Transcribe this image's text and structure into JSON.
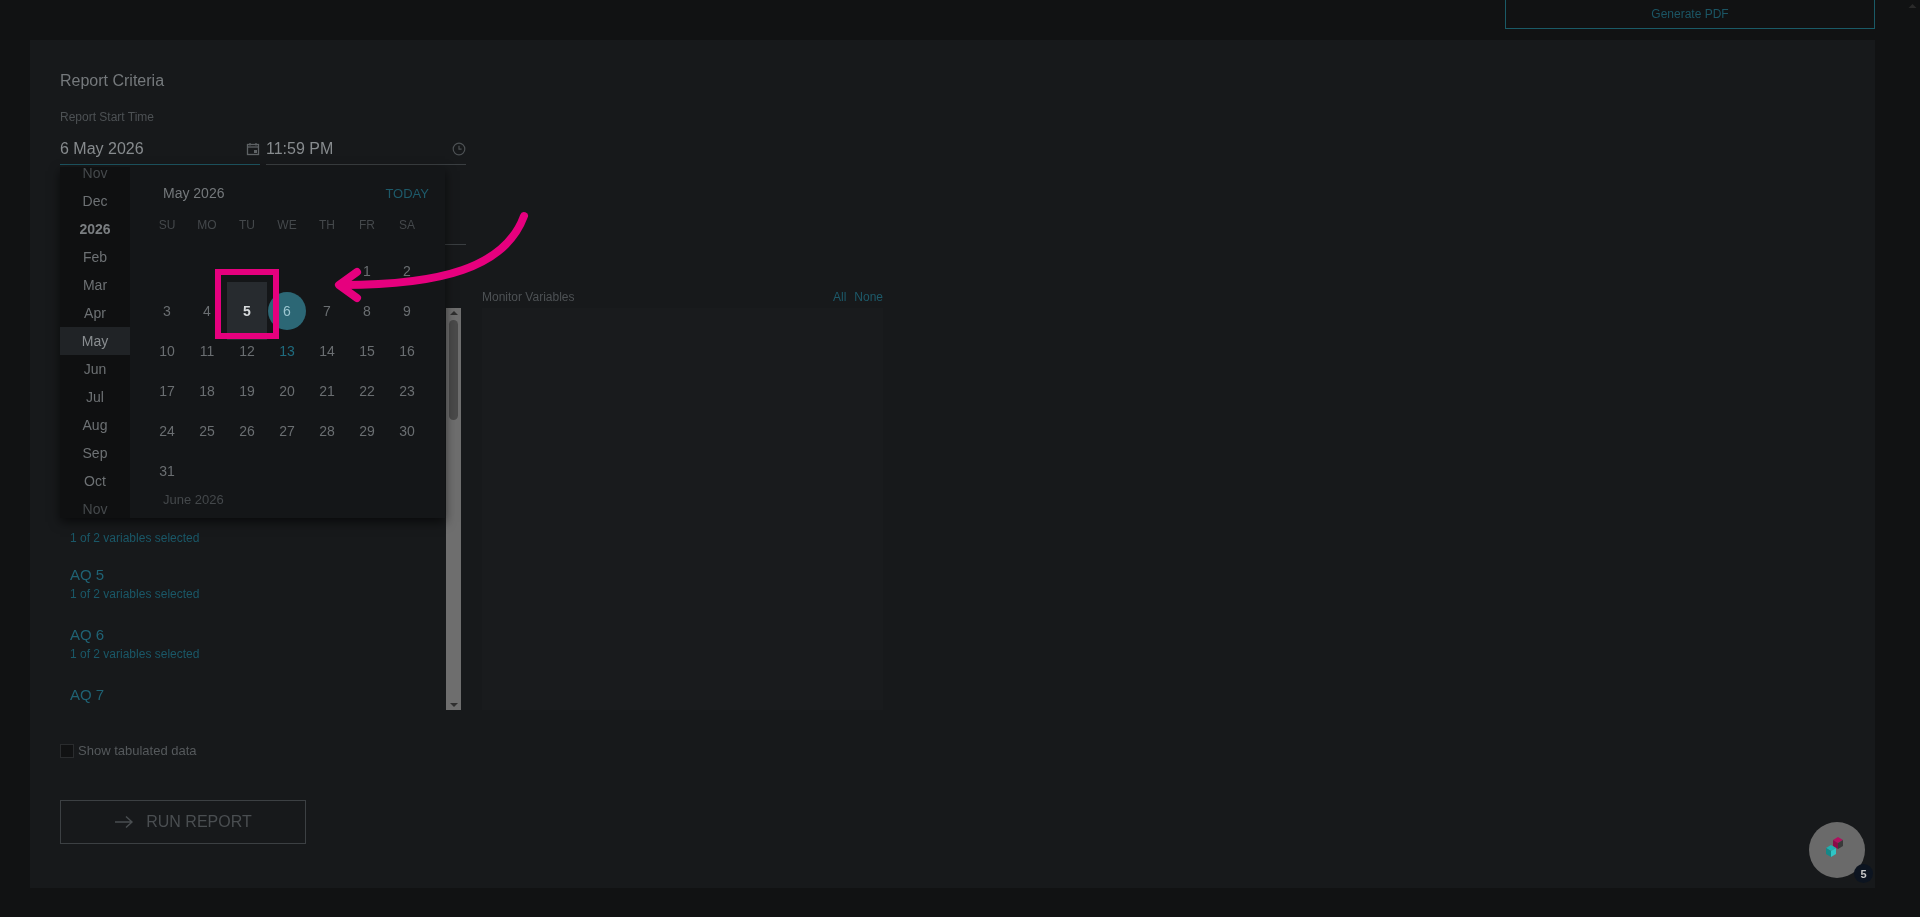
{
  "top_button": {
    "label": "Generate PDF"
  },
  "card": {
    "title": "Report Criteria",
    "start_label": "Report Start Time",
    "start_date": "6 May 2026",
    "start_time": "11:59 PM"
  },
  "picker": {
    "month_title": "May 2026",
    "today_label": "TODAY",
    "next_month": "June 2026",
    "weekdays": [
      "SU",
      "MO",
      "TU",
      "WE",
      "TH",
      "FR",
      "SA"
    ],
    "months": [
      {
        "label": "Nov",
        "kind": "month",
        "selected": false
      },
      {
        "label": "Dec",
        "kind": "month",
        "selected": false
      },
      {
        "label": "2026",
        "kind": "year",
        "selected": false
      },
      {
        "label": "Feb",
        "kind": "month",
        "selected": false
      },
      {
        "label": "Mar",
        "kind": "month",
        "selected": false
      },
      {
        "label": "Apr",
        "kind": "month",
        "selected": false
      },
      {
        "label": "May",
        "kind": "month",
        "selected": true
      },
      {
        "label": "Jun",
        "kind": "month",
        "selected": false
      },
      {
        "label": "Jul",
        "kind": "month",
        "selected": false
      },
      {
        "label": "Aug",
        "kind": "month",
        "selected": false
      },
      {
        "label": "Sep",
        "kind": "month",
        "selected": false
      },
      {
        "label": "Oct",
        "kind": "month",
        "selected": false
      },
      {
        "label": "Nov",
        "kind": "month",
        "selected": false
      }
    ],
    "days": [
      {
        "d": "1",
        "selected": false,
        "today": false,
        "hovered": false
      },
      {
        "d": "2",
        "selected": false,
        "today": false,
        "hovered": false
      },
      {
        "d": "3",
        "selected": false,
        "today": false,
        "hovered": false
      },
      {
        "d": "4",
        "selected": false,
        "today": false,
        "hovered": false
      },
      {
        "d": "5",
        "selected": false,
        "today": false,
        "hovered": true
      },
      {
        "d": "6",
        "selected": true,
        "today": false,
        "hovered": false
      },
      {
        "d": "7",
        "selected": false,
        "today": false,
        "hovered": false
      },
      {
        "d": "8",
        "selected": false,
        "today": false,
        "hovered": false
      },
      {
        "d": "9",
        "selected": false,
        "today": false,
        "hovered": false
      },
      {
        "d": "10",
        "selected": false,
        "today": false,
        "hovered": false
      },
      {
        "d": "11",
        "selected": false,
        "today": false,
        "hovered": false
      },
      {
        "d": "12",
        "selected": false,
        "today": false,
        "hovered": false
      },
      {
        "d": "13",
        "selected": false,
        "today": true,
        "hovered": false
      },
      {
        "d": "14",
        "selected": false,
        "today": false,
        "hovered": false
      },
      {
        "d": "15",
        "selected": false,
        "today": false,
        "hovered": false
      },
      {
        "d": "16",
        "selected": false,
        "today": false,
        "hovered": false
      },
      {
        "d": "17",
        "selected": false,
        "today": false,
        "hovered": false
      },
      {
        "d": "18",
        "selected": false,
        "today": false,
        "hovered": false
      },
      {
        "d": "19",
        "selected": false,
        "today": false,
        "hovered": false
      },
      {
        "d": "20",
        "selected": false,
        "today": false,
        "hovered": false
      },
      {
        "d": "21",
        "selected": false,
        "today": false,
        "hovered": false
      },
      {
        "d": "22",
        "selected": false,
        "today": false,
        "hovered": false
      },
      {
        "d": "23",
        "selected": false,
        "today": false,
        "hovered": false
      },
      {
        "d": "24",
        "selected": false,
        "today": false,
        "hovered": false
      },
      {
        "d": "25",
        "selected": false,
        "today": false,
        "hovered": false
      },
      {
        "d": "26",
        "selected": false,
        "today": false,
        "hovered": false
      },
      {
        "d": "27",
        "selected": false,
        "today": false,
        "hovered": false
      },
      {
        "d": "28",
        "selected": false,
        "today": false,
        "hovered": false
      },
      {
        "d": "29",
        "selected": false,
        "today": false,
        "hovered": false
      },
      {
        "d": "30",
        "selected": false,
        "today": false,
        "hovered": false
      },
      {
        "d": "31",
        "selected": false,
        "today": false,
        "hovered": false
      }
    ]
  },
  "monitors": [
    {
      "subtitle": "1 of 2 variables selected"
    },
    {
      "name": "AQ 5",
      "subtitle": "1 of 2 variables selected"
    },
    {
      "name": "AQ 6",
      "subtitle": "1 of 2 variables selected"
    },
    {
      "name": "AQ 7"
    }
  ],
  "variables": {
    "title": "Monitor Variables",
    "all": "All",
    "none": "None"
  },
  "show_tabulated": {
    "label": "Show tabulated data",
    "checked": false
  },
  "run_button": {
    "label": "RUN REPORT"
  },
  "help_badge": {
    "count": "5"
  }
}
